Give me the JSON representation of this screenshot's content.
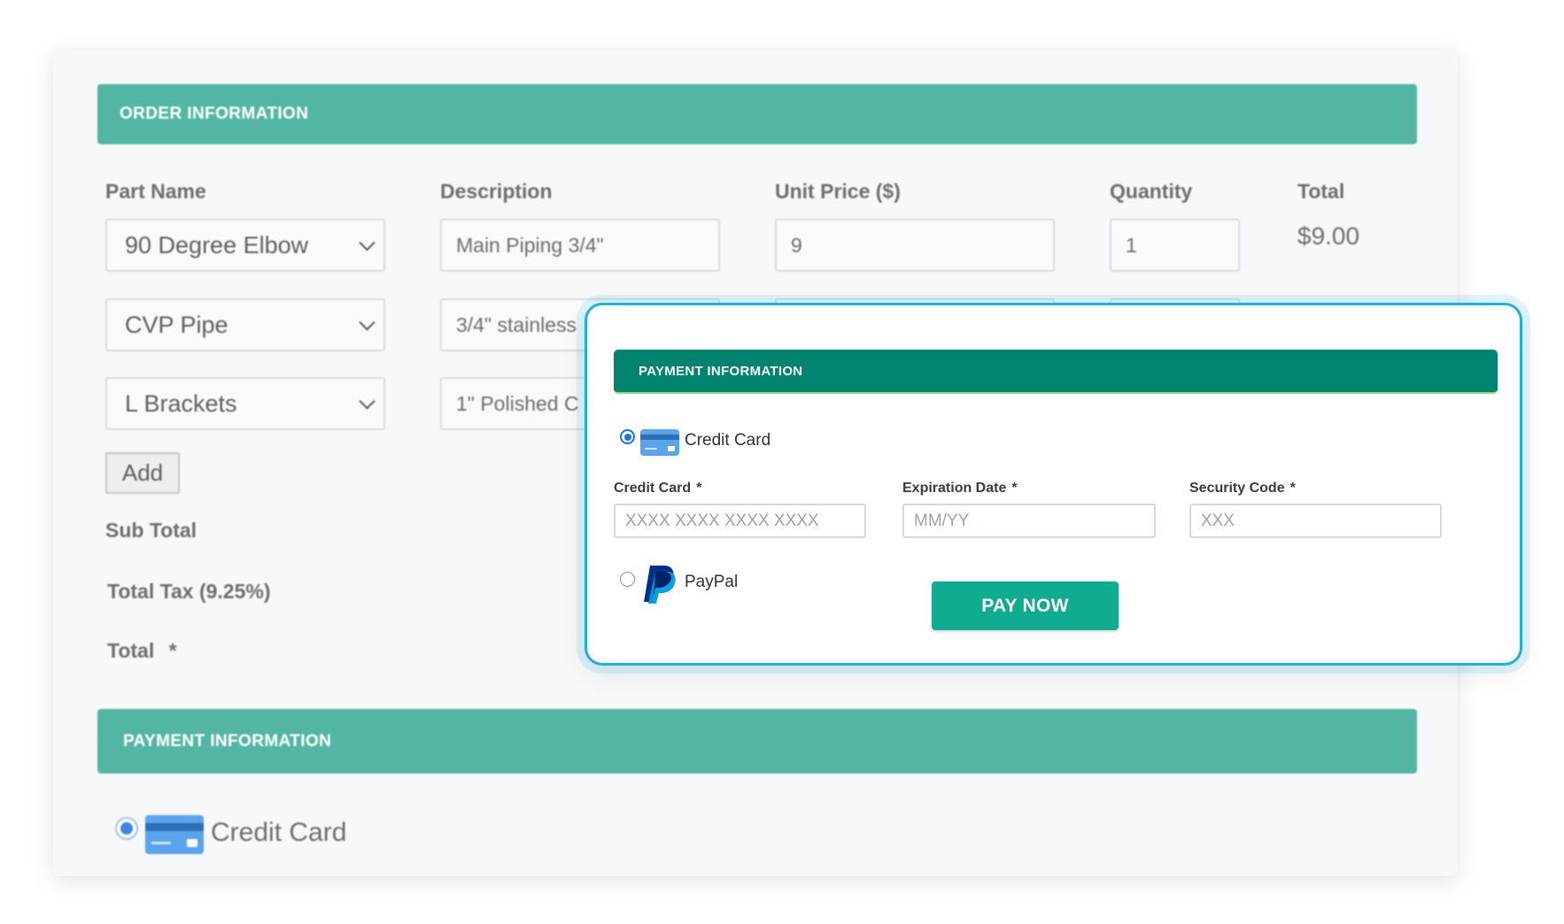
{
  "order": {
    "header": "ORDER INFORMATION",
    "columns": {
      "part_name": "Part Name",
      "description": "Description",
      "unit_price": "Unit Price ($)",
      "quantity": "Quantity",
      "total": "Total"
    },
    "rows": [
      {
        "part": "90 Degree Elbow",
        "description": "Main Piping 3/4\"",
        "unit_price": "9",
        "quantity": "1",
        "total": "$9.00"
      },
      {
        "part": "CVP Pipe",
        "description": "3/4\" stainless"
      },
      {
        "part": "L Brackets",
        "description": "1\" Polished C"
      }
    ],
    "add_label": "Add",
    "sub_total_label": "Sub Total",
    "tax_label": "Total Tax (9.25%)",
    "total_label": "Total",
    "required_mark": "*"
  },
  "background_payment": {
    "header": "PAYMENT INFORMATION",
    "credit_card_label": "Credit Card"
  },
  "modal": {
    "header": "PAYMENT INFORMATION",
    "options": {
      "credit_card": "Credit Card",
      "paypal": "PayPal"
    },
    "selected_option": "credit_card",
    "fields": {
      "card_number": {
        "label": "Credit Card",
        "placeholder": "XXXX XXXX XXXX XXXX",
        "value": ""
      },
      "expiration": {
        "label": "Expiration Date",
        "placeholder": "MM/YY",
        "value": ""
      },
      "security_code": {
        "label": "Security Code",
        "placeholder": "XXX",
        "value": ""
      }
    },
    "required_mark": "*",
    "pay_button": "PAY NOW"
  },
  "icons": {
    "credit_card": "credit-card-icon",
    "paypal": "paypal-logo-icon",
    "dropdown": "chevron-down-icon"
  },
  "colors": {
    "background_bar": "#53b6a5",
    "modal_bar": "#00836f",
    "modal_border": "#1fb1de",
    "pay_button": "#0fac8f",
    "radio_selected": "#1a73e8"
  }
}
